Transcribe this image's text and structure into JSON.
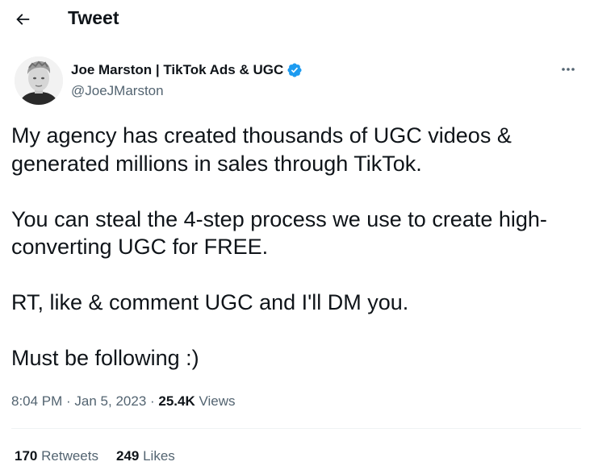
{
  "header": {
    "back_icon": "arrow-left-icon",
    "title": "Tweet"
  },
  "author": {
    "display_name": "Joe Marston | TikTok Ads & UGC",
    "handle": "@JoeJMarston",
    "verified_icon": "verified-badge-icon",
    "verified_color": "#1d9bf0",
    "more_icon": "more-horizontal-icon"
  },
  "tweet": {
    "paragraphs": [
      "My agency has created thousands of UGC videos & generated millions in sales through TikTok.",
      "You can steal the 4-step process we use to create high-converting UGC for FREE.",
      "RT, like & comment UGC and I'll DM you.",
      "Must be following :)"
    ]
  },
  "meta": {
    "time": "8:04 PM",
    "separator": " · ",
    "date": "Jan 5, 2023",
    "views_count": "25.4K",
    "views_label": "Views"
  },
  "stats": {
    "retweets_count": "170",
    "retweets_label": "Retweets",
    "likes_count": "249",
    "likes_label": "Likes"
  },
  "colors": {
    "text_primary": "#0f1419",
    "text_secondary": "#536471",
    "divider": "#eff3f4",
    "accent": "#1d9bf0"
  }
}
